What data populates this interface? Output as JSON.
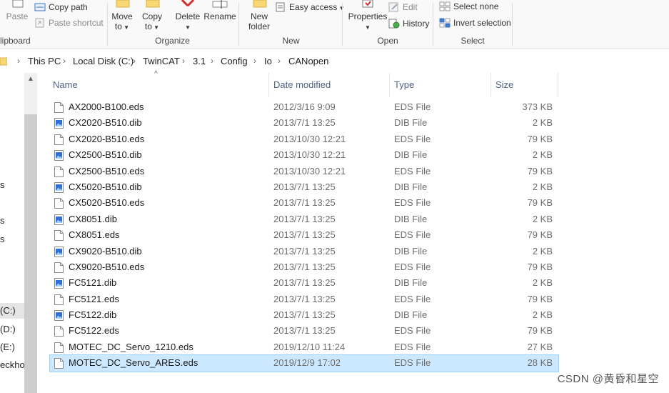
{
  "ribbon": {
    "clipboard": {
      "paste_label": "Paste",
      "copy_path_label": "Copy path",
      "paste_shortcut_label": "Paste shortcut",
      "group_label": "lipboard"
    },
    "organize": {
      "move_to_label": "Move",
      "move_to_sub": "to",
      "copy_to_label": "Copy",
      "copy_to_sub": "to",
      "delete_label": "Delete",
      "rename_label": "Rename",
      "group_label": "Organize"
    },
    "new": {
      "new_folder_label": "New",
      "new_folder_sub": "folder",
      "easy_access_label": "Easy access",
      "group_label": "New"
    },
    "open": {
      "properties_label": "Properties",
      "edit_label": "Edit",
      "history_label": "History",
      "group_label": "Open"
    },
    "select": {
      "select_none_label": "Select none",
      "invert_selection_label": "Invert selection",
      "group_label": "Select"
    }
  },
  "address": {
    "crumbs": [
      "This PC",
      "Local Disk (C:)",
      "TwinCAT",
      "3.1",
      "Config",
      "Io",
      "CANopen"
    ]
  },
  "nav": {
    "items": [
      {
        "label": "s"
      },
      {
        "label": "s"
      },
      {
        "label": "s"
      },
      {
        "label": "(C:)"
      },
      {
        "label": "(D:)"
      },
      {
        "label": "(E:)"
      },
      {
        "label": "eckhof"
      }
    ]
  },
  "columns": {
    "name": "Name",
    "date": "Date modified",
    "type": "Type",
    "size": "Size"
  },
  "files": [
    {
      "name": "AX2000-B100.eds",
      "date": "2012/3/16 9:09",
      "type": "EDS File",
      "size": "373 KB",
      "icon": "document-icon"
    },
    {
      "name": "CX2020-B510.dib",
      "date": "2013/7/1 13:25",
      "type": "DIB File",
      "size": "2 KB",
      "icon": "image-file-icon"
    },
    {
      "name": "CX2020-B510.eds",
      "date": "2013/10/30 12:21",
      "type": "EDS File",
      "size": "79 KB",
      "icon": "document-icon"
    },
    {
      "name": "CX2500-B510.dib",
      "date": "2013/10/30 12:21",
      "type": "DIB File",
      "size": "2 KB",
      "icon": "image-file-icon"
    },
    {
      "name": "CX2500-B510.eds",
      "date": "2013/10/30 12:21",
      "type": "EDS File",
      "size": "79 KB",
      "icon": "document-icon"
    },
    {
      "name": "CX5020-B510.dib",
      "date": "2013/7/1 13:25",
      "type": "DIB File",
      "size": "2 KB",
      "icon": "image-file-icon"
    },
    {
      "name": "CX5020-B510.eds",
      "date": "2013/7/1 13:25",
      "type": "EDS File",
      "size": "79 KB",
      "icon": "document-icon"
    },
    {
      "name": "CX8051.dib",
      "date": "2013/7/1 13:25",
      "type": "DIB File",
      "size": "2 KB",
      "icon": "image-file-icon"
    },
    {
      "name": "CX8051.eds",
      "date": "2013/7/1 13:25",
      "type": "EDS File",
      "size": "79 KB",
      "icon": "document-icon"
    },
    {
      "name": "CX9020-B510.dib",
      "date": "2013/7/1 13:25",
      "type": "DIB File",
      "size": "2 KB",
      "icon": "image-file-icon"
    },
    {
      "name": "CX9020-B510.eds",
      "date": "2013/7/1 13:25",
      "type": "EDS File",
      "size": "79 KB",
      "icon": "document-icon"
    },
    {
      "name": "FC5121.dib",
      "date": "2013/7/1 13:25",
      "type": "DIB File",
      "size": "2 KB",
      "icon": "image-file-icon"
    },
    {
      "name": "FC5121.eds",
      "date": "2013/7/1 13:25",
      "type": "EDS File",
      "size": "79 KB",
      "icon": "document-icon"
    },
    {
      "name": "FC5122.dib",
      "date": "2013/7/1 13:25",
      "type": "DIB File",
      "size": "2 KB",
      "icon": "image-file-icon"
    },
    {
      "name": "FC5122.eds",
      "date": "2013/7/1 13:25",
      "type": "EDS File",
      "size": "79 KB",
      "icon": "document-icon"
    },
    {
      "name": "MOTEC_DC_Servo_1210.eds",
      "date": "2019/12/10 11:24",
      "type": "EDS File",
      "size": "27 KB",
      "icon": "document-icon"
    },
    {
      "name": "MOTEC_DC_Servo_ARES.eds",
      "date": "2019/12/9 17:02",
      "type": "EDS File",
      "size": "28 KB",
      "icon": "document-icon",
      "selected": true
    }
  ],
  "watermark": "CSDN @黄昏和星空",
  "colors": {
    "selection_bg": "#cce8ff",
    "selection_border": "#99d1ff",
    "header_text": "#4d6584",
    "delete_red": "#d32f2f",
    "folder_yellow": "#f8d775"
  }
}
